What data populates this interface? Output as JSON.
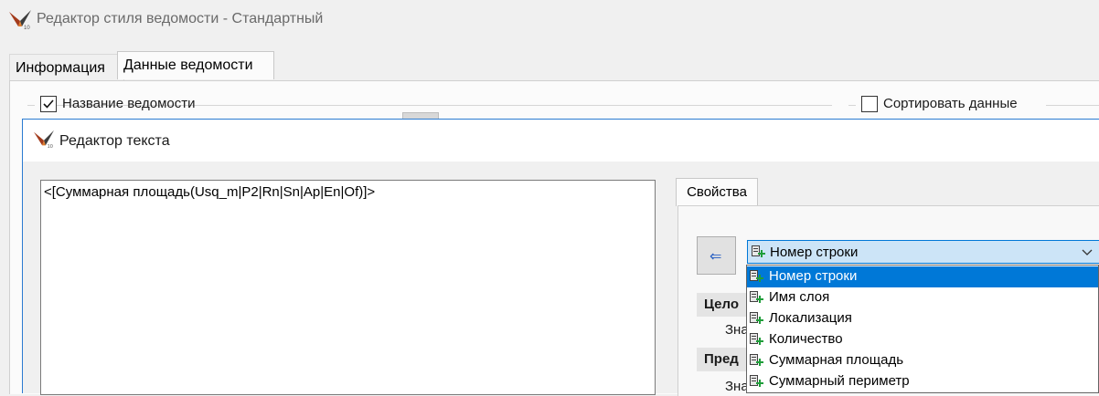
{
  "window": {
    "title": "Редактор стиля ведомости - Стандартный",
    "logo_icon": "app-logo-icon"
  },
  "tabs": [
    {
      "label": "Информация",
      "active": false
    },
    {
      "label": "Данные ведомости",
      "active": true
    }
  ],
  "options": {
    "name_checkbox": {
      "label": "Название ведомости",
      "checked": true
    },
    "sort_checkbox": {
      "label": "Сортировать данные",
      "checked": false
    }
  },
  "text_editor": {
    "title": "Редактор текста",
    "content": "<[Суммарная площадь(Usq_m|P2|Rn|Sn|Ap|En|Of)]>",
    "properties_tab": "Свойства",
    "insert_button_icon": "arrow-left-icon",
    "field_combo": {
      "selected": "Номер строки"
    },
    "groups": [
      {
        "header": "Цело",
        "field_label": "Зна"
      },
      {
        "header": "Пред",
        "field_label": "Зна"
      }
    ],
    "dropdown_items": [
      "Номер строки",
      "Имя слоя",
      "Локализация",
      "Количество",
      "Суммарная площадь",
      "Суммарный периметр"
    ],
    "selected_index": 0
  },
  "colors": {
    "accent": "#0078d7",
    "combo_bg": "#cce4f7"
  }
}
